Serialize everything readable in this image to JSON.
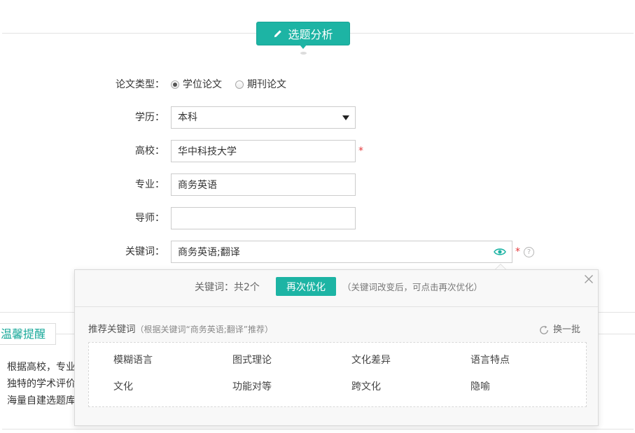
{
  "header": {
    "title": "选题分析",
    "icon": "pencil-icon"
  },
  "form": {
    "paper_type": {
      "label": "论文类型：",
      "options": [
        {
          "label": "学位论文",
          "selected": true
        },
        {
          "label": "期刊论文",
          "selected": false
        }
      ]
    },
    "education": {
      "label": "学历：",
      "value": "本科"
    },
    "university": {
      "label": "高校：",
      "value": "华中科技大学",
      "required_mark": "*"
    },
    "major": {
      "label": "专业：",
      "value": "商务英语"
    },
    "advisor": {
      "label": "导师：",
      "value": ""
    },
    "keywords": {
      "label": "关键词：",
      "value": "商务英语;翻译",
      "required_mark": "*",
      "help_text": "?",
      "view_icon": "eye-icon"
    }
  },
  "popup": {
    "count_text": "关键词：共2个",
    "reoptimize_label": "再次优化",
    "hint": "（关键词改变后，可点击再次优化）",
    "close_icon": "close-icon",
    "recommend_title": "推荐关键词",
    "recommend_note": "（根据关键词“商务英语;翻译”推荐）",
    "refresh_label": "换一批",
    "refresh_icon": "refresh-icon",
    "suggested_keywords": [
      "模糊语言",
      "图式理论",
      "文化差异",
      "语言特点",
      "文化",
      "功能对等",
      "跨文化",
      "隐喻"
    ]
  },
  "tips": {
    "tab_label": "温馨提醒",
    "lines": [
      "根据高校，专业",
      "独特的学术评价",
      "海量自建选题库"
    ]
  },
  "colors": {
    "accent": "#1db4a4",
    "required": "#e4393c"
  }
}
